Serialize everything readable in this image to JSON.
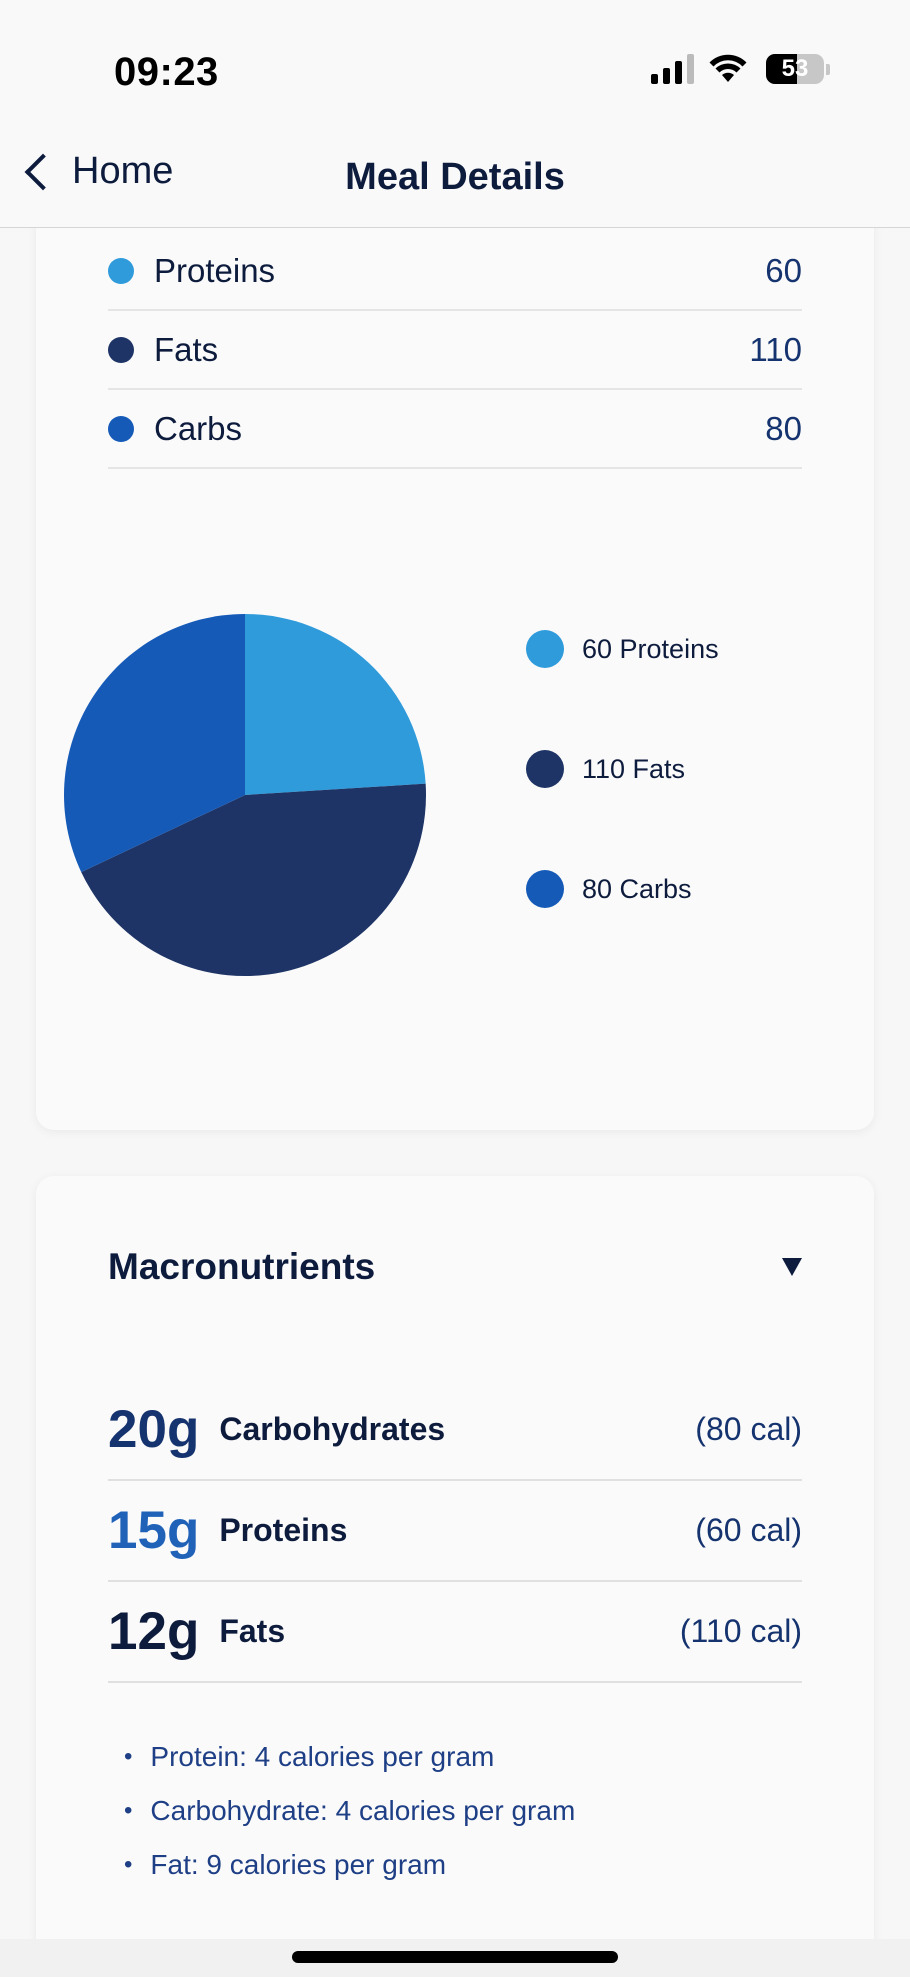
{
  "status_bar": {
    "time": "09:23",
    "battery": "53"
  },
  "nav": {
    "back_label": "Home",
    "title": "Meal Details"
  },
  "nutrients": [
    {
      "name": "Proteins",
      "value": "60",
      "color": "#2f9bdb"
    },
    {
      "name": "Fats",
      "value": "110",
      "color": "#1e3466"
    },
    {
      "name": "Carbs",
      "value": "80",
      "color": "#165ab8"
    }
  ],
  "chart_data": {
    "type": "pie",
    "categories": [
      "Proteins",
      "Fats",
      "Carbs"
    ],
    "values": [
      60,
      110,
      80
    ],
    "colors": [
      "#2f9bdb",
      "#1e3466",
      "#165ab8"
    ],
    "legend_labels": [
      "60 Proteins",
      "110 Fats",
      "80 Carbs"
    ],
    "legend_position": "right"
  },
  "macronutrients": {
    "title": "Macronutrients",
    "toggle_icon": "triangle-down-icon",
    "items": [
      {
        "grams": "20g",
        "name": "Carbohydrates",
        "calories": "(80 cal)",
        "gram_color": "#15336e"
      },
      {
        "grams": "15g",
        "name": "Proteins",
        "calories": "(60 cal)",
        "gram_color": "#1f62b8"
      },
      {
        "grams": "12g",
        "name": "Fats",
        "calories": "(110 cal)",
        "gram_color": "#0d1b3d"
      }
    ],
    "notes": [
      "Protein: 4 calories per gram",
      "Carbohydrate: 4 calories per gram",
      "Fat: 9 calories per gram"
    ]
  }
}
